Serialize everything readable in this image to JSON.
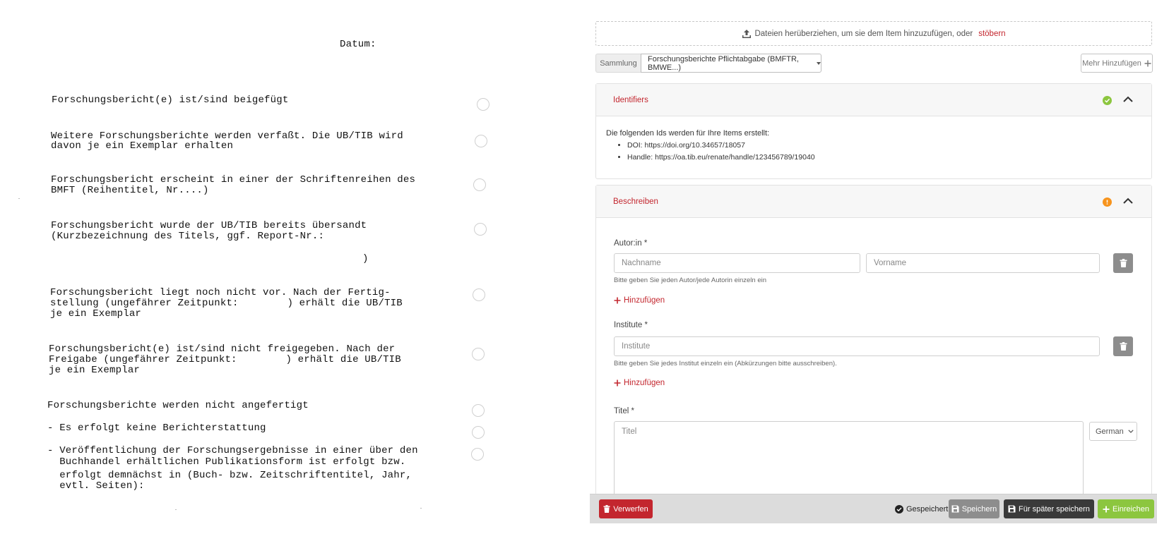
{
  "document": {
    "datum_label": "Datum:",
    "items": [
      {
        "lines": [
          "Forschungsbericht(e) ist/sind beigefügt"
        ]
      },
      {
        "lines": [
          "Weitere Forschungsberichte werden verfaßt. Die UB/TIB wird",
          "davon je ein Exemplar erhalten"
        ]
      },
      {
        "lines": [
          "Forschungsbericht erscheint in einer der Schriftenreihen des",
          "BMFT (Reihentitel, Nr....)"
        ]
      },
      {
        "lines": [
          "Forschungsbericht wurde der UB/TIB bereits übersandt",
          "(Kurzbezeichnung des Titels, ggf. Report-Nr.:"
        ],
        "closing": ")"
      },
      {
        "lines": [
          "Forschungsbericht liegt noch nicht vor. Nach der Fertig-",
          "stellung (ungefährer Zeitpunkt:        ) erhält die UB/TIB",
          "je ein Exemplar"
        ]
      },
      {
        "lines": [
          "Forschungsbericht(e) ist/sind nicht freigegeben. Nach der",
          "Freigabe (ungefährer Zeitpunkt:        ) erhält die UB/TIB",
          "je ein Exemplar"
        ]
      },
      {
        "lines": [
          "Forschungsberichte werden nicht angefertigt"
        ]
      },
      {
        "lines": [
          "- Es erfolgt keine Berichterstattung"
        ]
      },
      {
        "lines": [
          "- Veröffentlichung der Forschungsergebnisse in einer über den",
          "  Buchhandel erhältlichen Publikationsform ist erfolgt bzw.",
          "  erfolgt demnächst in (Buch- bzw. Zeitschriftentitel, Jahr,",
          "  evtl. Seiten):"
        ]
      }
    ]
  },
  "form": {
    "dropzone": {
      "text": "Dateien herüberziehen, um sie dem Item hinzuzufügen, oder",
      "link": "stöbern",
      "icon": "upload-icon"
    },
    "collection": {
      "label": "Sammlung",
      "value": "Forschungsberichte Pflichtabgabe (BMFTR, BMWE...)"
    },
    "more_button": "Mehr Hinzufügen",
    "identifiers": {
      "title": "Identifiers",
      "status": "complete",
      "status_color": "#8cc63f",
      "intro": "Die folgenden Ids werden für Ihre Items erstellt:",
      "items": [
        "DOI: https://doi.org/10.34657/18057",
        "Handle: https://oa.tib.eu/renate/handle/123456789/19040"
      ]
    },
    "describe": {
      "title": "Beschreiben",
      "status": "warning",
      "status_color": "#f7941d",
      "author": {
        "label": "Autor:in *",
        "lastname_placeholder": "Nachname",
        "firstname_placeholder": "Vorname",
        "help": "Bitte geben Sie jeden Autor/jede Autorin einzeln ein",
        "add": "Hinzufügen"
      },
      "institute": {
        "label": "Institute *",
        "placeholder": "Institute",
        "help": "Bitte geben Sie jedes Institut einzeln ein (Abkürzungen bitte ausschreiben).",
        "add": "Hinzufügen"
      },
      "title_field": {
        "label": "Titel *",
        "placeholder": "Titel",
        "language": "German"
      }
    },
    "toolbar": {
      "discard": "Verwerfen",
      "saved": "Gespeichert",
      "save": "Speichern",
      "save_later": "Für später speichern",
      "submit": "Einreichen",
      "colors": {
        "discard": "#c3262e",
        "save": "#8d8d8d",
        "save_later": "#3a3a3a",
        "submit": "#8cc63f"
      }
    }
  }
}
